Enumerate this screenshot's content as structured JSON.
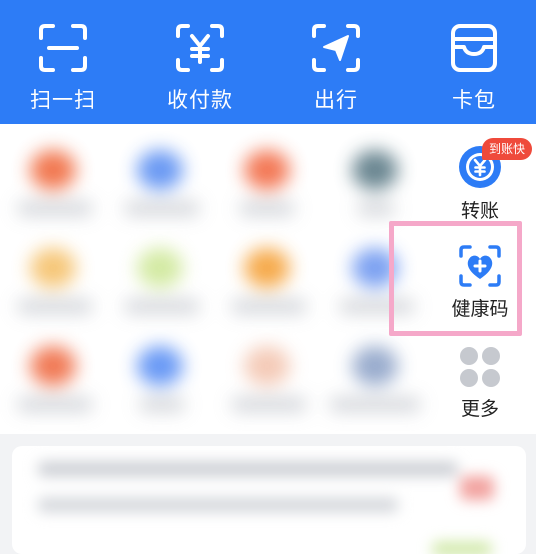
{
  "topbar": {
    "items": [
      {
        "label": "扫一扫",
        "icon": "scan-icon"
      },
      {
        "label": "收付款",
        "icon": "yuan-receipt-icon"
      },
      {
        "label": "出行",
        "icon": "travel-arrow-icon"
      },
      {
        "label": "卡包",
        "icon": "wallet-icon"
      }
    ],
    "background": "#2d7cf6"
  },
  "shortcuts": {
    "transfer": {
      "label": "转账",
      "badge": "到账快",
      "icon": "transfer-yuan-icon"
    },
    "health_code": {
      "label": "健康码",
      "icon": "health-heart-icon"
    },
    "more": {
      "label": "更多",
      "icon": "more-grid-icon"
    }
  },
  "colors": {
    "accent": "#2d7cf6",
    "badge": "#ef4a3b",
    "highlight": "#f5a8c9"
  }
}
